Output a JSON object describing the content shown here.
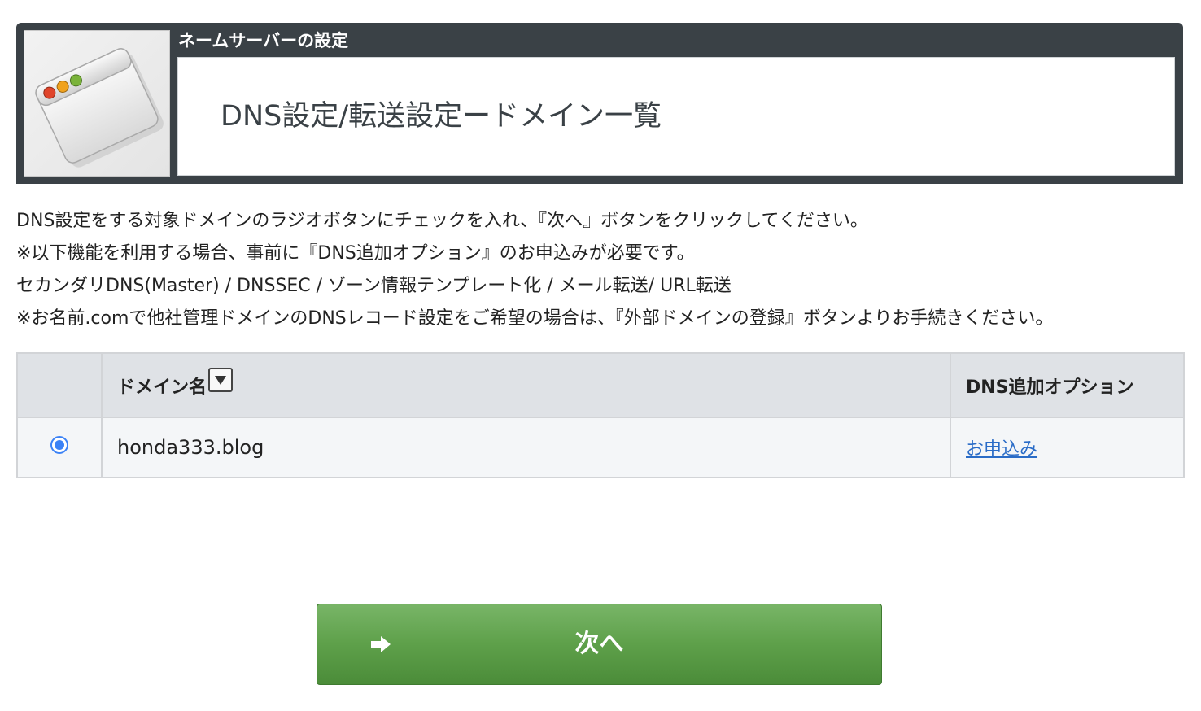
{
  "header": {
    "category": "ネームサーバーの設定",
    "title": "DNS設定/転送設定ードメイン一覧",
    "icon": "browser-window-icon"
  },
  "instructions": [
    "DNS設定をする対象ドメインのラジオボタンにチェックを入れ、『次へ』ボタンをクリックしてください。",
    "※以下機能を利用する場合、事前に『DNS追加オプション』のお申込みが必要です。",
    "セカンダリDNS(Master) / DNSSEC / ゾーン情報テンプレート化 / メール転送/ URL転送",
    "※お名前.comで他社管理ドメインのDNSレコード設定をご希望の場合は、『外部ドメインの登録』ボタンよりお手続きください。"
  ],
  "table": {
    "columns": {
      "select": "",
      "domain": "ドメイン名",
      "option": "DNS追加オプション"
    },
    "sort_icon": "sort-down-icon",
    "rows": [
      {
        "selected": true,
        "domain": "honda333.blog",
        "option_link": "お申込み"
      }
    ]
  },
  "next_button": {
    "label": "次へ",
    "icon": "arrow-right-icon"
  },
  "colors": {
    "header_bg": "#3a4146",
    "button_green": "#5ea04a",
    "link_blue": "#2a6cc7",
    "radio_blue": "#3b82f6",
    "table_header_bg": "#dfe2e6"
  }
}
